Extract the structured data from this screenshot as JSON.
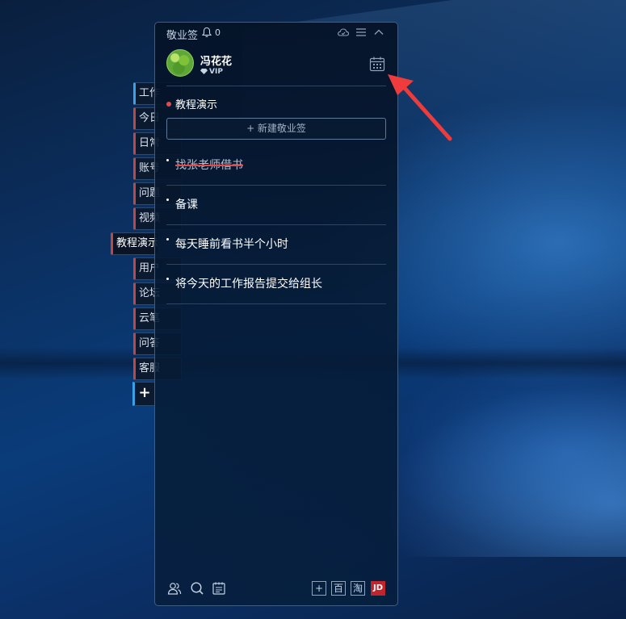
{
  "side_tabs": [
    {
      "label": "工作",
      "accent": "#3aa0e8"
    },
    {
      "label": "今日",
      "accent": "#b84a4a"
    },
    {
      "label": "日常",
      "accent": "#b84a4a"
    },
    {
      "label": "账号",
      "accent": "#b84a4a"
    },
    {
      "label": "问题",
      "accent": "#b84a4a"
    },
    {
      "label": "视频",
      "accent": "#b84a4a"
    },
    {
      "label": "教程演示",
      "accent": "#b84a4a"
    },
    {
      "label": "用户",
      "accent": "#b84a4a"
    },
    {
      "label": "论坛",
      "accent": "#b84a4a"
    },
    {
      "label": "云笔",
      "accent": "#b84a4a"
    },
    {
      "label": "问答",
      "accent": "#b84a4a"
    },
    {
      "label": "客服",
      "accent": "#b84a4a"
    }
  ],
  "side_add_label": "+",
  "app": {
    "name": "敬业签",
    "notification_count": "0"
  },
  "user": {
    "name": "冯花花",
    "badge": "VIP"
  },
  "category": {
    "name": "教程演示",
    "dot_color": "#e24b4b"
  },
  "new_note_button": "+ 新建敬业签",
  "todos": [
    {
      "text": "找张老师借书",
      "done": true
    },
    {
      "text": "备课",
      "done": false
    },
    {
      "text": "每天睡前看书半个小时",
      "done": false
    },
    {
      "text": "将今天的工作报告提交给组长",
      "done": false
    }
  ],
  "footer": {
    "left_icons": [
      "contacts-icon",
      "search-icon",
      "notes-icon"
    ],
    "right_buttons": [
      "+",
      "百",
      "淘",
      "JD"
    ]
  },
  "colors": {
    "accent_red": "#e24b4b",
    "arrow_red": "#ee3b3b",
    "jd_red": "#c0252b"
  }
}
